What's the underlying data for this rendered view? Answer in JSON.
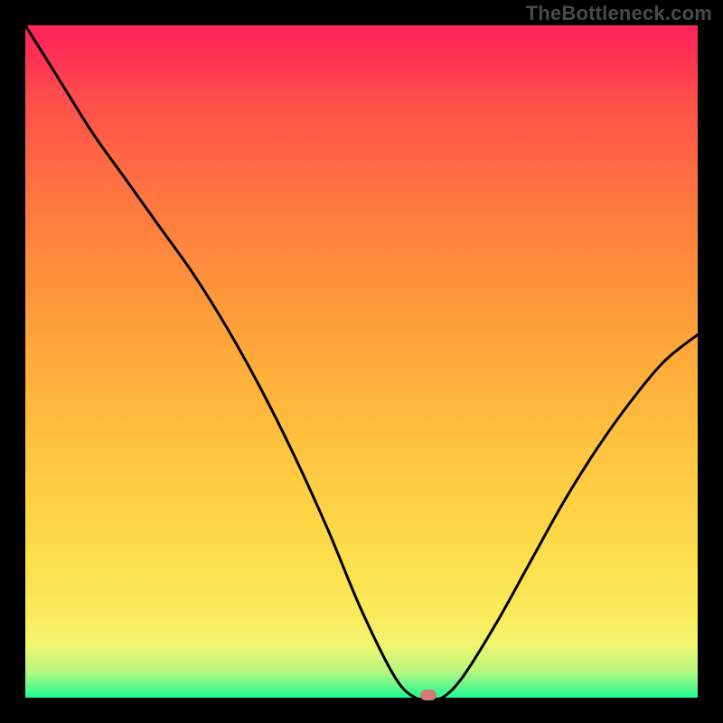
{
  "watermark": "TheBottleneck.com",
  "chart_data": {
    "type": "line",
    "title": "",
    "xlabel": "",
    "ylabel": "",
    "xlim": [
      0,
      100
    ],
    "ylim": [
      0,
      100
    ],
    "gradient_colors": {
      "bottom": "#1efc8f",
      "mid": "#fce24f",
      "top": "#ff245b"
    },
    "x": [
      0,
      5,
      10,
      15,
      20,
      25,
      30,
      35,
      40,
      45,
      50,
      55,
      58,
      60,
      62,
      65,
      70,
      75,
      80,
      85,
      90,
      95,
      100
    ],
    "y": [
      100,
      92,
      84,
      77,
      70,
      63,
      55,
      46,
      36,
      25,
      13,
      3,
      0,
      0,
      0,
      3,
      11,
      20,
      29,
      37,
      44,
      50,
      54
    ],
    "flat_region": {
      "x_start": 56,
      "x_end": 62,
      "value": 0
    },
    "marker": {
      "x": 60,
      "y": 0,
      "color": "#d07a7a"
    }
  }
}
